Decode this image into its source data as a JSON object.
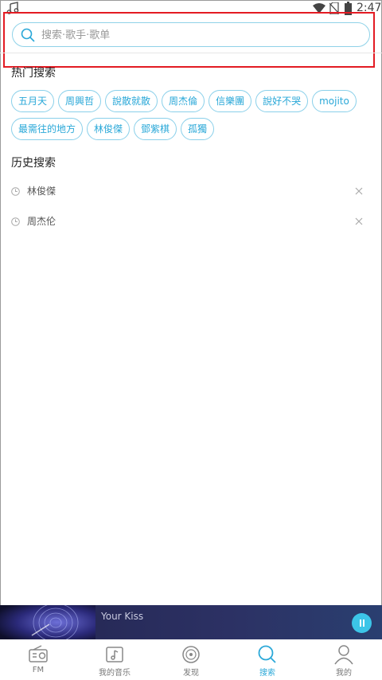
{
  "status_bar": {
    "time": "2:47"
  },
  "search": {
    "placeholder": "搜索·歌手·歌单"
  },
  "hot_section": {
    "title": "热门搜索",
    "tags": [
      "五月天",
      "周興哲",
      "說散就散",
      "周杰倫",
      "信樂團",
      "說好不哭",
      "mojito",
      "最需往的地方",
      "林俊傑",
      "鄧紫棋",
      "孤獨"
    ]
  },
  "history_section": {
    "title": "历史搜索",
    "items": [
      "林俊傑",
      "周杰伦"
    ]
  },
  "player": {
    "song_title": "Your Kiss"
  },
  "bottom_nav": [
    {
      "label": "FM",
      "icon": "radio-icon"
    },
    {
      "label": "我的音乐",
      "icon": "music-icon"
    },
    {
      "label": "发现",
      "icon": "disc-icon"
    },
    {
      "label": "搜索",
      "icon": "search-icon"
    },
    {
      "label": "我的",
      "icon": "user-icon"
    }
  ],
  "colors": {
    "accent": "#2aa8d8",
    "highlight_box": "#e31b23",
    "player_bg": "#2c3164"
  }
}
